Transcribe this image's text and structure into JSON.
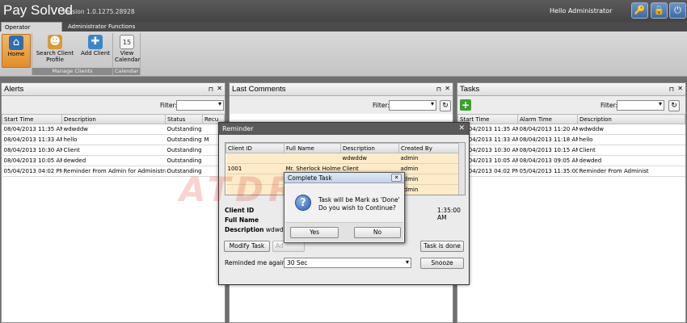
{
  "app": {
    "title": "Pay Solved",
    "version": "Version 1.0.1275.28928",
    "greeting": "Hello Administrator"
  },
  "title_buttons": [
    {
      "icon": "key-icon",
      "glyph": "🔑"
    },
    {
      "icon": "lock-icon",
      "glyph": "🔒"
    },
    {
      "icon": "power-icon",
      "glyph": "⏻"
    }
  ],
  "ribbon": {
    "tabs": [
      "Operator Functions",
      "Administrator Functions"
    ],
    "groups": [
      {
        "label": "",
        "buttons": [
          {
            "label": "Home",
            "icon": "home-icon"
          }
        ]
      },
      {
        "label": "Manage Clients",
        "buttons": [
          {
            "label": "Search Client Profile",
            "icon": "search-client-icon"
          },
          {
            "label": "Add Client",
            "icon": "add-client-icon"
          }
        ]
      },
      {
        "label": "Calendar",
        "buttons": [
          {
            "label": "View Calendar",
            "icon": "calendar-icon"
          }
        ]
      }
    ]
  },
  "alerts": {
    "title": "Alerts",
    "filter_label": "Filter:",
    "columns": [
      "Start Time",
      "Description",
      "Status",
      "Recu"
    ],
    "rows": [
      [
        "08/04/2013 11:35 AM",
        "wdwddw",
        "Outstanding",
        ""
      ],
      [
        "08/04/2013 11:33 AM",
        "hello",
        "Outstanding",
        "M"
      ],
      [
        "08/04/2013 10:30 AM",
        "Client",
        "Outstanding",
        ""
      ],
      [
        "08/04/2013 10:05 AM",
        "dewded",
        "Outstanding",
        ""
      ],
      [
        "05/04/2013 04:02 PM",
        "Reminder From Admin for Administrator",
        "Outstanding",
        ""
      ]
    ]
  },
  "comments": {
    "title": "Last Comments",
    "filter_label": "Filter:"
  },
  "tasks": {
    "title": "Tasks",
    "filter_label": "Filter:",
    "columns": [
      "Start Time",
      "Alarm Time",
      "Description"
    ],
    "rows": [
      [
        "08/04/2013 11:35 AM",
        "08/04/2013 11:20 AM",
        "wdwddw"
      ],
      [
        "08/04/2013 11:33 AM",
        "08/04/2013 11:18 AM",
        "hello"
      ],
      [
        "08/04/2013 10:30 AM",
        "08/04/2013 10:15 AM",
        "Client"
      ],
      [
        "08/04/2013 10:05 AM",
        "08/04/2013 09:05 AM",
        "dewded"
      ],
      [
        "05/04/2013 04:02 PM",
        "05/04/2013 11:35:00 AM",
        "Reminder From Administ"
      ]
    ]
  },
  "reminder": {
    "title": "Reminder",
    "columns": [
      "Client ID",
      "Full Name",
      "Description",
      "Created By"
    ],
    "rows": [
      [
        "",
        "",
        "wdwddw",
        "admin"
      ],
      [
        "1001",
        "Mr. Sherlock Holmes",
        "Client",
        "admin"
      ],
      [
        "",
        "",
        "",
        "admin"
      ],
      [
        "",
        "",
        "",
        "admin"
      ]
    ],
    "client_id_label": "Client ID",
    "full_name_label": "Full Name",
    "description_label": "Description",
    "description_value": "wdwddw",
    "side_time": "1:35:00 AM",
    "modify_button": "Modify Task",
    "add_button": "Ad",
    "task_done_button": "Task is done",
    "reminded_label": "Reminded me again in",
    "reminded_value": "30 Sec",
    "snooze_button": "Snooze"
  },
  "complete_task": {
    "title": "Complete Task",
    "message_line1": "Task will be Mark as 'Done'",
    "message_line2": "Do you wish to Continue?",
    "yes_button": "Yes",
    "no_button": "No"
  },
  "watermark": "ATDRIVE"
}
